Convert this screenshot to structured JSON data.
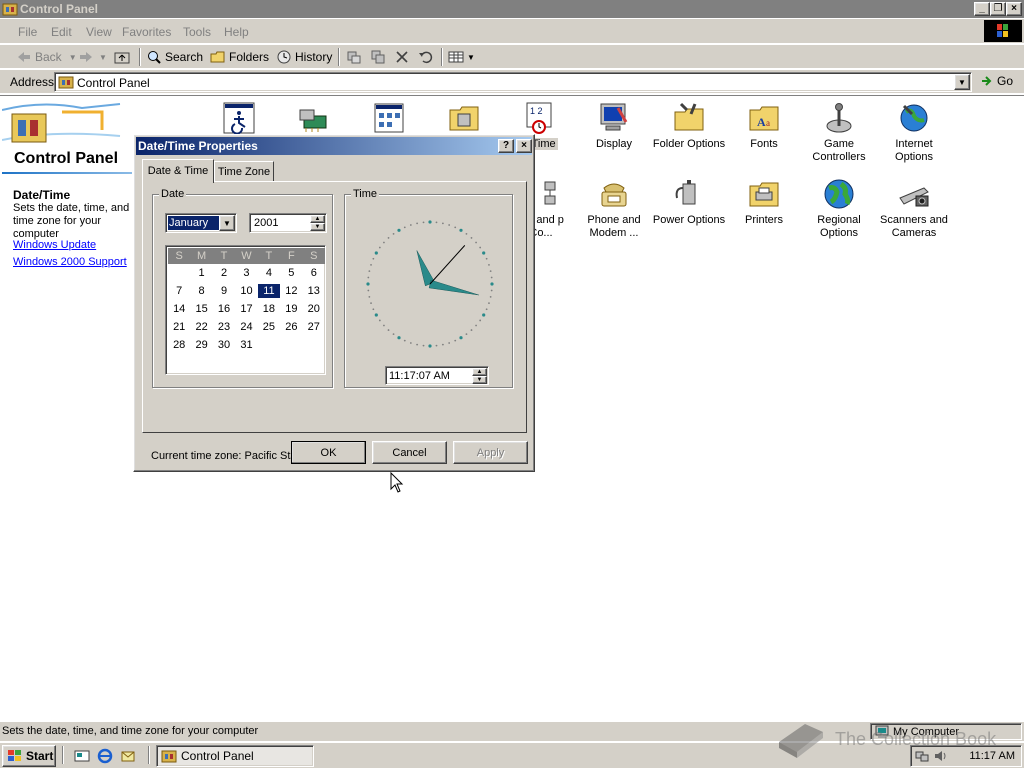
{
  "window": {
    "title": "Control Panel"
  },
  "menu": [
    "File",
    "Edit",
    "View",
    "Favorites",
    "Tools",
    "Help"
  ],
  "toolbar": {
    "back": "Back",
    "search": "Search",
    "folders": "Folders",
    "history": "History"
  },
  "address": {
    "label": "Address",
    "value": "Control Panel",
    "go": "Go"
  },
  "sidebar": {
    "title": "Control Panel",
    "info_title": "Date/Time",
    "info_desc": "Sets the date, time, and time zone for your computer",
    "links": [
      "Windows Update",
      "Windows 2000 Support"
    ]
  },
  "icons": {
    "row1": [
      {
        "label": "",
        "icon": "accessibility-icon"
      },
      {
        "label": "",
        "icon": "add-hardware-icon"
      },
      {
        "label": "",
        "icon": "add-remove-programs-icon"
      },
      {
        "label": "",
        "icon": "administrative-tools-icon"
      },
      {
        "label": "e/Time",
        "icon": "date-time-icon"
      },
      {
        "label": "Display",
        "icon": "display-icon"
      },
      {
        "label": "Folder Options",
        "icon": "folder-options-icon"
      },
      {
        "label": "Fonts",
        "icon": "fonts-icon"
      },
      {
        "label": "Game Controllers",
        "icon": "game-controllers-icon"
      },
      {
        "label": "Internet Options",
        "icon": "internet-options-icon"
      }
    ],
    "row2": [
      {
        "label": "ork and p Co...",
        "icon": "network-icon"
      },
      {
        "label": "Phone and Modem ...",
        "icon": "phone-modem-icon"
      },
      {
        "label": "Power Options",
        "icon": "power-options-icon"
      },
      {
        "label": "Printers",
        "icon": "printers-icon"
      },
      {
        "label": "Regional Options",
        "icon": "regional-options-icon"
      },
      {
        "label": "Scanners and Cameras",
        "icon": "scanners-cameras-icon"
      }
    ]
  },
  "status": {
    "text": "Sets the date, time, and time zone for your computer",
    "zone": "My Computer"
  },
  "taskbar": {
    "start": "Start",
    "task": "Control Panel",
    "clock": "11:17 AM"
  },
  "watermark": "The Collection Book",
  "dialog": {
    "title": "Date/Time Properties",
    "tabs": [
      "Date & Time",
      "Time Zone"
    ],
    "date_group": "Date",
    "time_group": "Time",
    "month": "January",
    "year": "2001",
    "weekdays": [
      "S",
      "M",
      "T",
      "W",
      "T",
      "F",
      "S"
    ],
    "first_weekday_index": 1,
    "days_in_month": 31,
    "selected_day": 11,
    "time": "11:17:07 AM",
    "clock": {
      "hour": 11,
      "minute": 17,
      "second": 7
    },
    "timezone_label": "Current time zone:",
    "timezone_value": "Pacific Standard Time",
    "buttons": {
      "ok": "OK",
      "cancel": "Cancel",
      "apply": "Apply"
    }
  },
  "colors": {
    "title_active": "#0a246a",
    "title_inactive": "#808080",
    "face": "#d4d0c8",
    "clock_hands": "#2a8a8a"
  }
}
